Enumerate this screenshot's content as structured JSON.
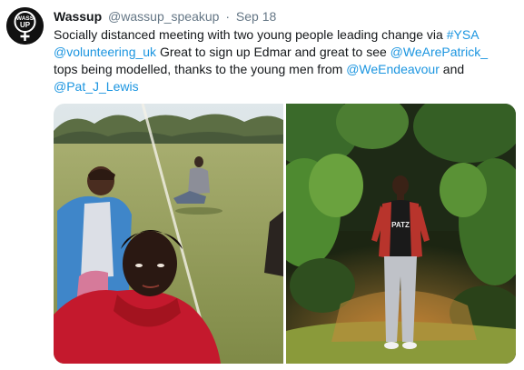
{
  "tweet": {
    "display_name": "Wassup",
    "handle": "@wassup_speakup",
    "separator": "·",
    "date": "Sep 18",
    "avatar_text": "WASS UP",
    "body": {
      "line1_text": "Socially distanced meeting with two young people leading  change via ",
      "line1_link": "#YSA",
      "line2_link1": "@volunteering_uk",
      "line2_text": "  Great to sign up Edmar and great to see ",
      "line2_link2": "@WeArePatrick_",
      "line3_text1": "tops being modelled, thanks to the young men  from ",
      "line3_link": "@WeEndeavour",
      "line3_text2": "  and",
      "line4_link": "@Pat_J_Lewis"
    },
    "media": {
      "left_photo": "group-selfie-photo",
      "right_photo": "young-man-portrait-photo",
      "shirt_text": "PATZ"
    }
  },
  "colors": {
    "link": "#1b95e0",
    "secondary_text": "#657786",
    "primary_text": "#14171a"
  }
}
